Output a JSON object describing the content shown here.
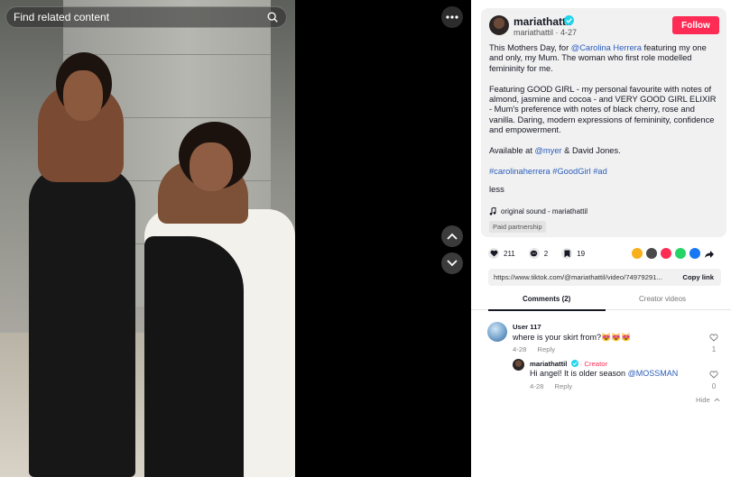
{
  "search": {
    "placeholder": "Find related content"
  },
  "author": {
    "name": "mariathattil",
    "handle": "mariathattil",
    "date": "4-27",
    "follow_label": "Follow"
  },
  "description": {
    "p1_pre": "This Mothers Day, for ",
    "p1_link": "@Carolina Herrera",
    "p1_post": " featuring my one and only, my Mum. The woman who first role modelled femininity for me.",
    "p2": "Featuring GOOD GIRL - my personal favourite with notes of almond, jasmine and cocoa - and VERY GOOD GIRL ELIXIR - Mum's preference with notes of black cherry, rose and vanilla. Daring, modern expressions of femininity, confidence and empowerment.",
    "p3_pre": "Available at ",
    "p3_link": "@myer",
    "p3_post": " & David Jones.",
    "hashtags": "#carolinaherrera #GoodGirl #ad",
    "less_label": "less",
    "sound": "original sound - mariathattil",
    "partnership": "Paid partnership"
  },
  "stats": {
    "likes": "211",
    "comments": "2",
    "saves": "19"
  },
  "share_colors": [
    "#f7b01b",
    "#4a4a4a",
    "#fe2c55",
    "#25d366",
    "#1877f2",
    "#161823"
  ],
  "link": {
    "url": "https://www.tiktok.com/@mariathattil/video/74979291...",
    "copy_label": "Copy link"
  },
  "tabs": {
    "comments": "Comments (2)",
    "creator_videos": "Creator videos"
  },
  "comments": [
    {
      "user": "User 117",
      "text": "where is your skirt from?😻😻😻",
      "date": "4-28",
      "reply": "Reply",
      "likes": "1"
    },
    {
      "user": "mariathattil",
      "creator_tag": "· Creator",
      "text_pre": "Hi angel! It is older season ",
      "text_link": "@MOSSMAN",
      "date": "4-28",
      "reply": "Reply",
      "likes": "0"
    }
  ],
  "hide_label": "Hide"
}
